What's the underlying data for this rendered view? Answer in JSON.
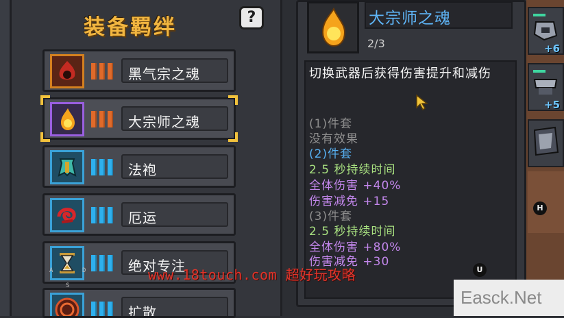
{
  "set_panel": {
    "title": "装备羁绊",
    "help_label": "?",
    "sets": [
      {
        "name": "黑气宗之魂",
        "color": "orange",
        "icon": "dark-flame-icon",
        "selected": false
      },
      {
        "name": "大宗师之魂",
        "color": "orange",
        "icon": "golden-flame-icon",
        "selected": true
      },
      {
        "name": "法袍",
        "color": "blue",
        "icon": "robe-icon",
        "selected": false
      },
      {
        "name": "厄运",
        "color": "blue",
        "icon": "red-swirl-icon",
        "selected": false
      },
      {
        "name": "绝对专注",
        "color": "blue",
        "icon": "hourglass-icon",
        "selected": false
      },
      {
        "name": "扩散",
        "color": "blue",
        "icon": "target-ring-icon",
        "selected": false
      }
    ]
  },
  "detail": {
    "title": "大宗师之魂",
    "count": "2/3",
    "description": "切换武器后获得伤害提升和减伤",
    "lines": [
      {
        "text": "(1)件套",
        "tone": "gray"
      },
      {
        "text": "没有效果",
        "tone": "gray"
      },
      {
        "text": "(2)件套",
        "tone": "blue"
      },
      {
        "text": "2.5 秒持续时间",
        "tone": "green"
      },
      {
        "text": "全体伤害 +40%",
        "tone": "purple"
      },
      {
        "text": "伤害减免 +15",
        "tone": "purple"
      },
      {
        "text": "(3)件套",
        "tone": "gray"
      },
      {
        "text": "2.5 秒持续时间",
        "tone": "green"
      },
      {
        "text": "全体伤害 +80%",
        "tone": "purple"
      },
      {
        "text": "伤害减免 +30",
        "tone": "purple"
      }
    ],
    "key_hint": "U"
  },
  "side_slots": [
    {
      "plus": "+6"
    },
    {
      "plus": "+5"
    },
    {
      "plus": ""
    }
  ],
  "side_key_hint": "H",
  "row_key_letters": [
    "A",
    "S",
    "D"
  ],
  "watermark": "www.18touch.com 超好玩攻略",
  "site_badge": "Easck.Net",
  "colors": {
    "title_gold": "#f2b640",
    "accent_blue": "#57b0f2",
    "bonus_green": "#a8e080",
    "bonus_purple": "#c387ec",
    "orange_bar": "#e06a2a",
    "blue_bar": "#2eb0ee"
  }
}
